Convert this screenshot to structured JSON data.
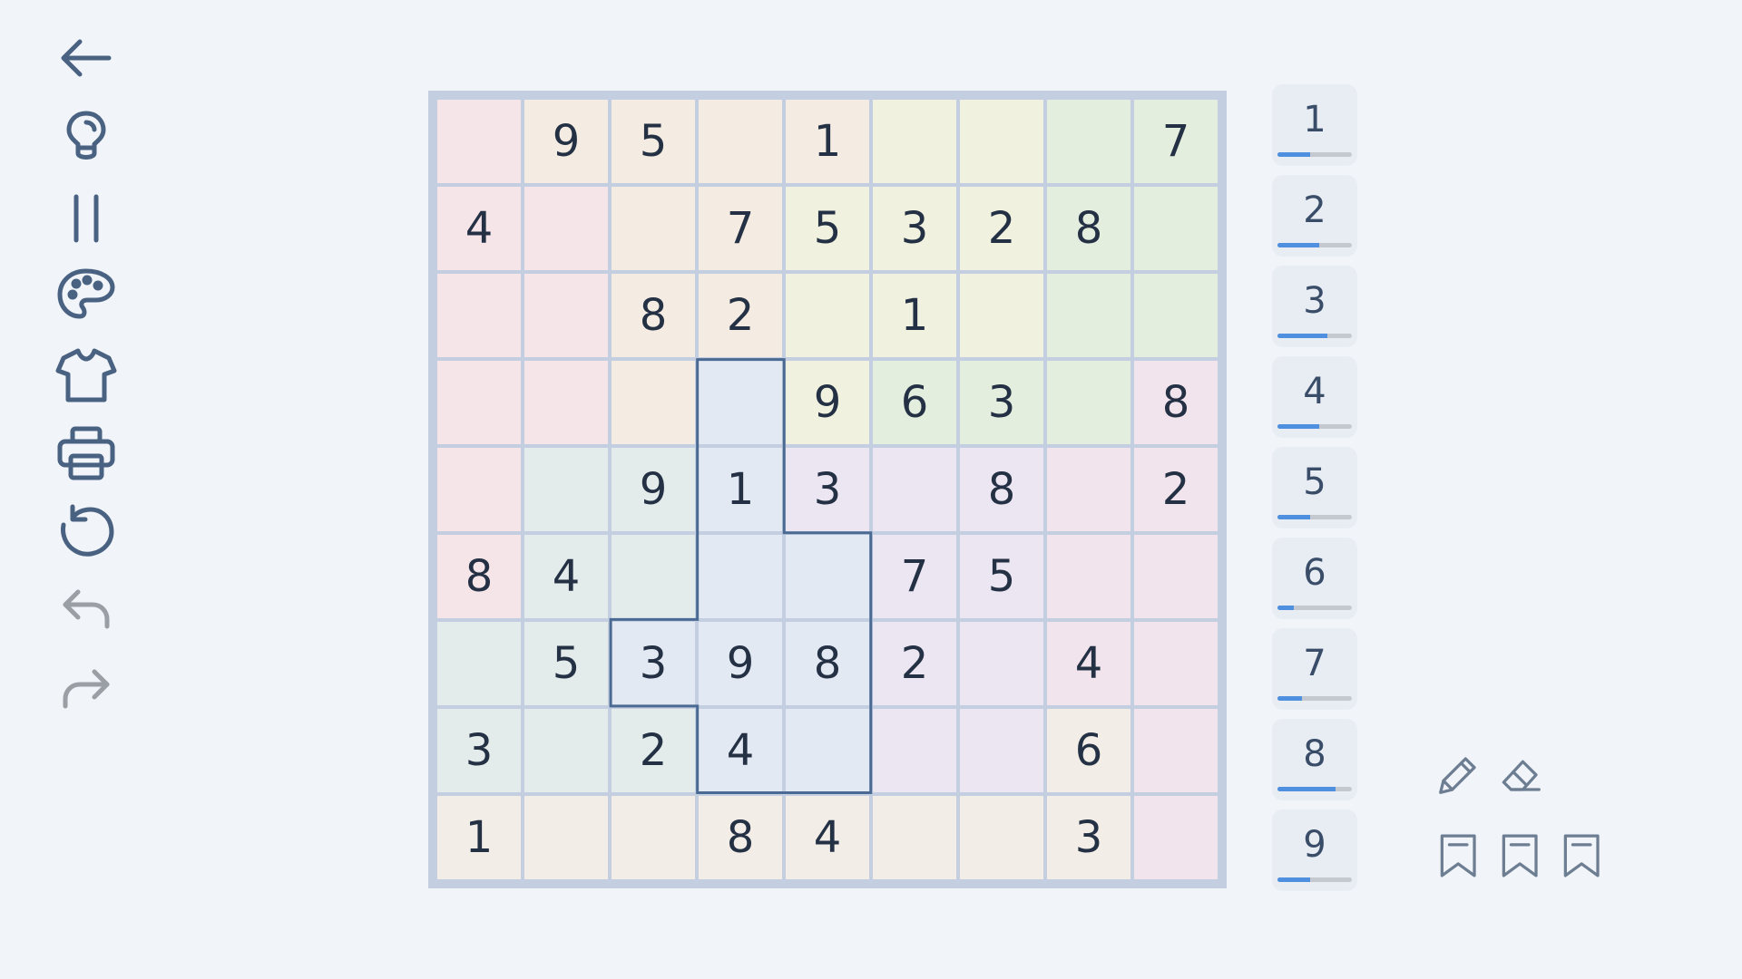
{
  "toolbar": {
    "tools": [
      {
        "name": "back-arrow-icon",
        "enabled": true
      },
      {
        "name": "lightbulb-hint-icon",
        "enabled": true
      },
      {
        "name": "pause-icon",
        "enabled": true
      },
      {
        "name": "palette-icon",
        "enabled": true
      },
      {
        "name": "shirt-icon",
        "enabled": true
      },
      {
        "name": "printer-icon",
        "enabled": true
      },
      {
        "name": "restart-icon",
        "enabled": true
      },
      {
        "name": "undo-icon",
        "enabled": false
      },
      {
        "name": "redo-icon",
        "enabled": false
      }
    ],
    "icon_color": "#4a6282",
    "disabled_color": "#9a9fa6"
  },
  "board": {
    "cells": [
      [
        "",
        "9",
        "5",
        "",
        "1",
        "",
        "",
        "",
        "7"
      ],
      [
        "4",
        "",
        "",
        "7",
        "5",
        "3",
        "2",
        "8",
        ""
      ],
      [
        "",
        "",
        "8",
        "2",
        "",
        "1",
        "",
        "",
        ""
      ],
      [
        "",
        "",
        "",
        "",
        "9",
        "6",
        "3",
        "",
        "8"
      ],
      [
        "",
        "",
        "9",
        "1",
        "3",
        "",
        "8",
        "",
        "2"
      ],
      [
        "8",
        "4",
        "",
        "",
        "",
        "7",
        "5",
        "",
        ""
      ],
      [
        "",
        "5",
        "3",
        "9",
        "8",
        "2",
        "",
        "4",
        ""
      ],
      [
        "3",
        "",
        "2",
        "4",
        "",
        "",
        "",
        "6",
        ""
      ],
      [
        "1",
        "",
        "",
        "8",
        "4",
        "",
        "",
        "3",
        ""
      ]
    ],
    "regions": [
      [
        0,
        1,
        1,
        1,
        1,
        2,
        2,
        3,
        3
      ],
      [
        0,
        0,
        1,
        1,
        2,
        2,
        2,
        3,
        3
      ],
      [
        0,
        0,
        1,
        1,
        2,
        2,
        2,
        3,
        3
      ],
      [
        0,
        0,
        1,
        4,
        2,
        3,
        3,
        3,
        6
      ],
      [
        0,
        5,
        5,
        4,
        7,
        7,
        7,
        6,
        6
      ],
      [
        0,
        5,
        5,
        4,
        4,
        7,
        7,
        6,
        6
      ],
      [
        5,
        5,
        4,
        4,
        4,
        7,
        7,
        6,
        6
      ],
      [
        5,
        5,
        5,
        4,
        4,
        7,
        7,
        8,
        6
      ],
      [
        8,
        8,
        8,
        8,
        8,
        8,
        8,
        8,
        6
      ]
    ],
    "region_colors": [
      "#f5e5e8",
      "#f4ece2",
      "#f0f1df",
      "#e4eedf",
      "#e3e9f3",
      "#e3ecea",
      "#f2e4ec",
      "#ece5f2",
      "#f2ede6"
    ],
    "highlight_region": 4,
    "highlight_color": "#4a6a93"
  },
  "numpad": {
    "digits": [
      {
        "label": "1",
        "progress": 0.44
      },
      {
        "label": "2",
        "progress": 0.56
      },
      {
        "label": "3",
        "progress": 0.67
      },
      {
        "label": "4",
        "progress": 0.56
      },
      {
        "label": "5",
        "progress": 0.44
      },
      {
        "label": "6",
        "progress": 0.22
      },
      {
        "label": "7",
        "progress": 0.33
      },
      {
        "label": "8",
        "progress": 0.78
      },
      {
        "label": "9",
        "progress": 0.44
      }
    ]
  },
  "side_tools": [
    {
      "name": "pencil-icon"
    },
    {
      "name": "eraser-icon"
    },
    {
      "name": "bookmark-icon-1"
    },
    {
      "name": "bookmark-icon-2"
    },
    {
      "name": "bookmark-icon-3"
    }
  ]
}
